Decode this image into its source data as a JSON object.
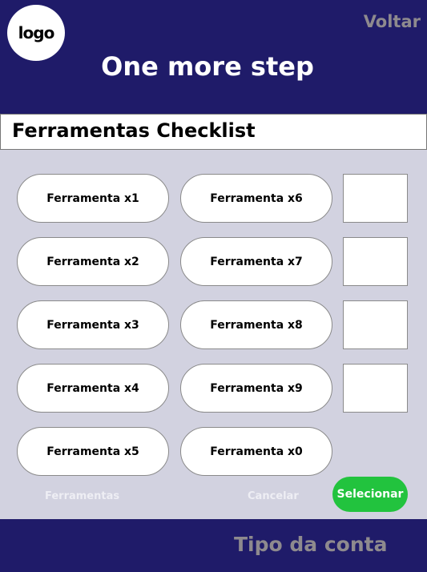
{
  "header": {
    "logo_text": "logo",
    "back_label": "Voltar",
    "title": "One more step"
  },
  "checklist": {
    "title": "Ferramentas Checklist",
    "tools_left": [
      "Ferramenta x1",
      "Ferramenta x2",
      "Ferramenta x3",
      "Ferramenta x4",
      "Ferramenta x5"
    ],
    "tools_right": [
      "Ferramenta x6",
      "Ferramenta x7",
      "Ferramenta x8",
      "Ferramenta x9",
      "Ferramenta x0"
    ]
  },
  "actions": {
    "tools_label": "Ferramentas",
    "cancel_label": "Cancelar",
    "select_label": "Selecionar"
  },
  "bottom": {
    "account_type_label": "Tipo da conta"
  },
  "colors": {
    "primary": "#1f1b69",
    "content_bg": "#d2d2e0",
    "accent_green": "#22c33e",
    "muted_text": "#8e8a8e"
  }
}
